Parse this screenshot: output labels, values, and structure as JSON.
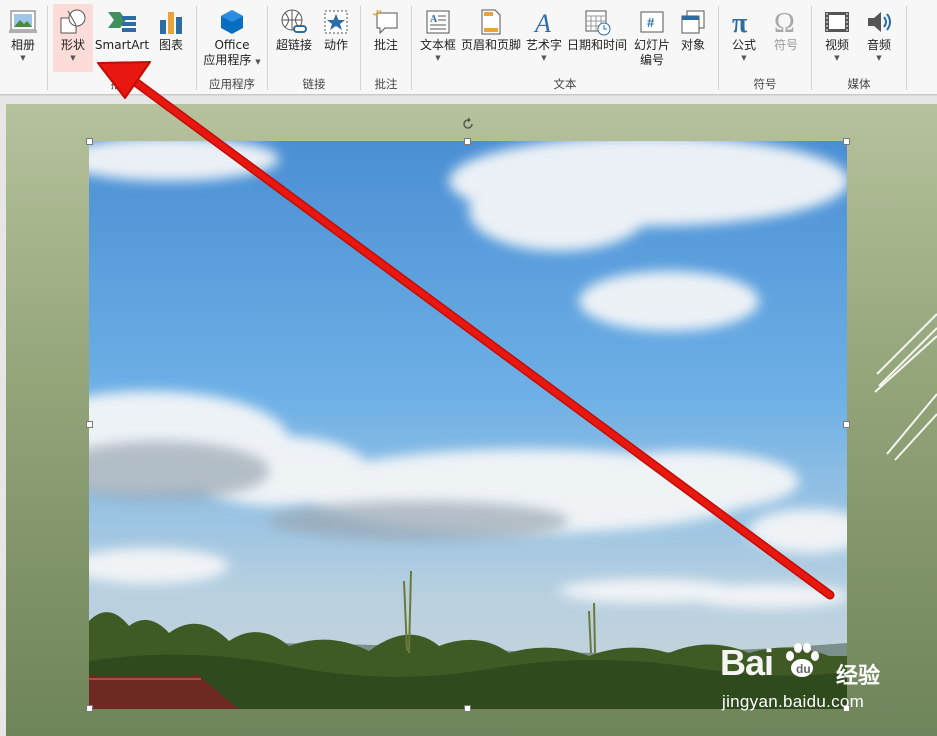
{
  "ribbon": {
    "groups": {
      "images_partial": {
        "label": ""
      },
      "illustrations": {
        "label": "插图"
      },
      "apps": {
        "label": "应用程序"
      },
      "links": {
        "label": "链接"
      },
      "comments": {
        "label": "批注"
      },
      "text": {
        "label": "文本"
      },
      "symbols": {
        "label": "符号"
      },
      "media": {
        "label": "媒体"
      }
    },
    "buttons": {
      "album": {
        "label": "相册",
        "icon": "photo-album-icon"
      },
      "shapes": {
        "label": "形状",
        "icon": "shapes-icon"
      },
      "smartart": {
        "label": "SmartArt",
        "icon": "smartart-icon"
      },
      "chart": {
        "label": "图表",
        "icon": "chart-icon"
      },
      "office_apps": {
        "label_line1": "Office",
        "label_line2": "应用程序",
        "icon": "office-apps-icon"
      },
      "hyperlink": {
        "label": "超链接",
        "icon": "hyperlink-icon"
      },
      "action": {
        "label": "动作",
        "icon": "action-icon"
      },
      "comment": {
        "label": "批注",
        "icon": "comment-icon"
      },
      "textbox": {
        "label": "文本框",
        "icon": "textbox-icon"
      },
      "header_footer": {
        "label": "页眉和页脚",
        "icon": "header-footer-icon"
      },
      "wordart": {
        "label": "艺术字",
        "icon": "wordart-icon"
      },
      "datetime": {
        "label": "日期和时间",
        "icon": "date-time-icon"
      },
      "slide_number": {
        "label_line1": "幻灯片",
        "label_line2": "编号",
        "icon": "slide-number-icon"
      },
      "object": {
        "label": "对象",
        "icon": "object-icon"
      },
      "equation": {
        "label": "公式",
        "icon": "equation-icon"
      },
      "symbol": {
        "label": "符号",
        "icon": "symbol-icon"
      },
      "video": {
        "label": "视频",
        "icon": "video-icon"
      },
      "audio": {
        "label": "音频",
        "icon": "audio-icon"
      }
    }
  },
  "colors": {
    "accent_red": "#e8170f",
    "active_button_bg": "#fbdcd8",
    "slide_top": "#b6c29c",
    "slide_bottom": "#6e8459"
  },
  "watermark": {
    "brand": "Bai",
    "brand_suffix": "经验",
    "url": "jingyan.baidu.com"
  }
}
